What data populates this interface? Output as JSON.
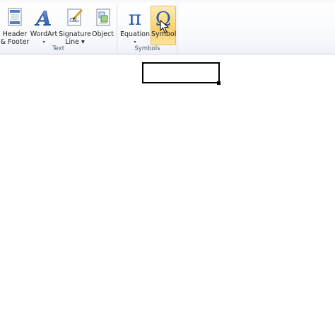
{
  "ribbon": {
    "groups": [
      {
        "label": "Text",
        "buttons": [
          {
            "line1": "Header",
            "line2": "& Footer",
            "icon": "header-footer-icon"
          },
          {
            "line1": "WordArt",
            "line2": "▾",
            "icon": "wordart-icon"
          },
          {
            "line1": "Signature",
            "line2": "Line ▾",
            "icon": "signature-line-icon"
          },
          {
            "line1": "Object",
            "line2": "",
            "icon": "object-icon"
          }
        ]
      },
      {
        "label": "Symbols",
        "buttons": [
          {
            "line1": "Equation",
            "line2": "▾",
            "icon": "pi-icon"
          },
          {
            "line1": "Symbol",
            "line2": "",
            "icon": "omega-icon",
            "highlighted": true
          }
        ]
      }
    ]
  },
  "colors": {
    "accent_highlight": "#fcd97a",
    "icon_blue": "#2a5aa8",
    "group_label": "#4c5a70"
  }
}
